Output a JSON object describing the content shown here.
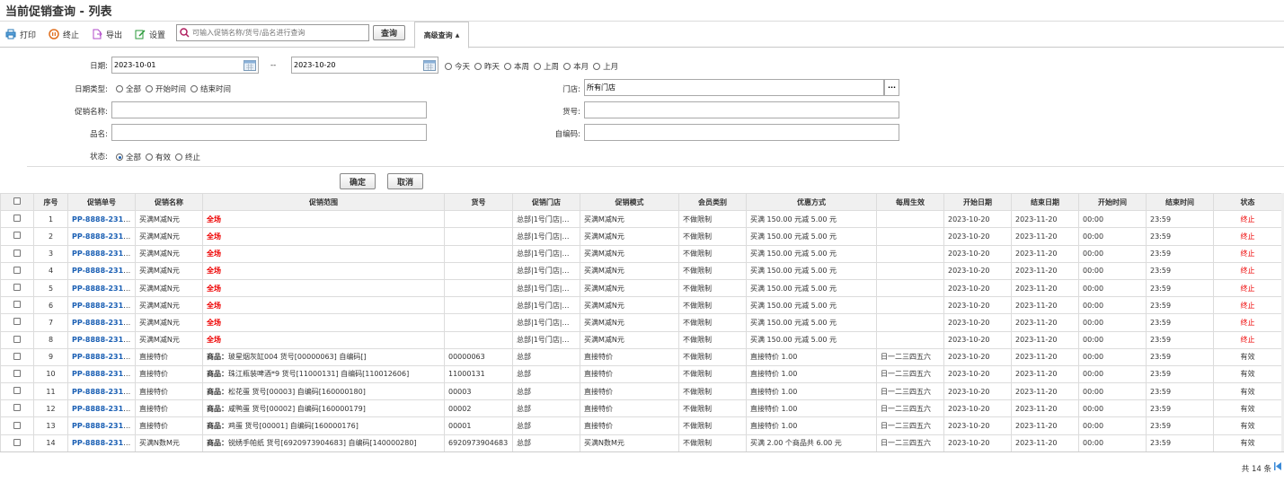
{
  "title": "当前促销查询 - 列表",
  "toolbar": {
    "print": "打印",
    "stop": "终止",
    "export": "导出",
    "settings": "设置",
    "search_placeholder": "可输入促销名称/货号/品名进行查询",
    "query": "查询",
    "advanced": "高级查询"
  },
  "form": {
    "date_label": "日期:",
    "date_from": "2023-10-01",
    "date_sep": "--",
    "date_to": "2023-10-20",
    "date_quick": [
      "今天",
      "昨天",
      "本周",
      "上周",
      "本月",
      "上月"
    ],
    "date_type_label": "日期类型:",
    "date_types": [
      "全部",
      "开始时间",
      "结束时间"
    ],
    "store_label": "门店:",
    "store_value": "所有门店",
    "store_more": "···",
    "promo_name_label": "促销名称:",
    "item_no_label": "货号:",
    "product_name_label": "品名:",
    "self_code_label": "自编码:",
    "status_label": "状态:",
    "statuses": [
      "全部",
      "有效",
      "终止"
    ],
    "confirm": "确定",
    "cancel": "取消"
  },
  "table": {
    "headers": [
      "序号",
      "促销单号",
      "促销名称",
      "促销范围",
      "货号",
      "促销门店",
      "促销模式",
      "会员类别",
      "优惠方式",
      "每周生效",
      "开始日期",
      "结束日期",
      "开始时间",
      "结束时间",
      "状态"
    ],
    "rows": [
      {
        "no": "1",
        "id": "PP-8888-2310...",
        "name": "买满M减N元",
        "scope": "全场",
        "item": "",
        "store": "总部|1号门店|测...",
        "mode": "买满M减N元",
        "member": "不做限制",
        "discount": "买满 150.00 元减 5.00 元",
        "weekly": "",
        "start_date": "2023-10-20",
        "end_date": "2023-11-20",
        "start_time": "00:00",
        "end_time": "23:59",
        "status": "终止"
      },
      {
        "no": "2",
        "id": "PP-8888-2310...",
        "name": "买满M减N元",
        "scope": "全场",
        "item": "",
        "store": "总部|1号门店|测...",
        "mode": "买满M减N元",
        "member": "不做限制",
        "discount": "买满 150.00 元减 5.00 元",
        "weekly": "",
        "start_date": "2023-10-20",
        "end_date": "2023-11-20",
        "start_time": "00:00",
        "end_time": "23:59",
        "status": "终止"
      },
      {
        "no": "3",
        "id": "PP-8888-2310...",
        "name": "买满M减N元",
        "scope": "全场",
        "item": "",
        "store": "总部|1号门店|测...",
        "mode": "买满M减N元",
        "member": "不做限制",
        "discount": "买满 150.00 元减 5.00 元",
        "weekly": "",
        "start_date": "2023-10-20",
        "end_date": "2023-11-20",
        "start_time": "00:00",
        "end_time": "23:59",
        "status": "终止"
      },
      {
        "no": "4",
        "id": "PP-8888-2310...",
        "name": "买满M减N元",
        "scope": "全场",
        "item": "",
        "store": "总部|1号门店|测...",
        "mode": "买满M减N元",
        "member": "不做限制",
        "discount": "买满 150.00 元减 5.00 元",
        "weekly": "",
        "start_date": "2023-10-20",
        "end_date": "2023-11-20",
        "start_time": "00:00",
        "end_time": "23:59",
        "status": "终止"
      },
      {
        "no": "5",
        "id": "PP-8888-2310...",
        "name": "买满M减N元",
        "scope": "全场",
        "item": "",
        "store": "总部|1号门店|测...",
        "mode": "买满M减N元",
        "member": "不做限制",
        "discount": "买满 150.00 元减 5.00 元",
        "weekly": "",
        "start_date": "2023-10-20",
        "end_date": "2023-11-20",
        "start_time": "00:00",
        "end_time": "23:59",
        "status": "终止"
      },
      {
        "no": "6",
        "id": "PP-8888-2310...",
        "name": "买满M减N元",
        "scope": "全场",
        "item": "",
        "store": "总部|1号门店|测...",
        "mode": "买满M减N元",
        "member": "不做限制",
        "discount": "买满 150.00 元减 5.00 元",
        "weekly": "",
        "start_date": "2023-10-20",
        "end_date": "2023-11-20",
        "start_time": "00:00",
        "end_time": "23:59",
        "status": "终止"
      },
      {
        "no": "7",
        "id": "PP-8888-2310...",
        "name": "买满M减N元",
        "scope": "全场",
        "item": "",
        "store": "总部|1号门店|测...",
        "mode": "买满M减N元",
        "member": "不做限制",
        "discount": "买满 150.00 元减 5.00 元",
        "weekly": "",
        "start_date": "2023-10-20",
        "end_date": "2023-11-20",
        "start_time": "00:00",
        "end_time": "23:59",
        "status": "终止"
      },
      {
        "no": "8",
        "id": "PP-8888-2310...",
        "name": "买满M减N元",
        "scope": "全场",
        "item": "",
        "store": "总部|1号门店|测...",
        "mode": "买满M减N元",
        "member": "不做限制",
        "discount": "买满 150.00 元减 5.00 元",
        "weekly": "",
        "start_date": "2023-10-20",
        "end_date": "2023-11-20",
        "start_time": "00:00",
        "end_time": "23:59",
        "status": "终止"
      },
      {
        "no": "9",
        "id": "PP-8888-2310...",
        "name": "直接特价",
        "scope_prefix": "商品：",
        "scope": "玻星烟灰缸004 货号[00000063] 自编码[]",
        "item": "00000063",
        "store": "总部",
        "mode": "直接特价",
        "member": "不做限制",
        "discount": "直接特价 1.00",
        "weekly": "日一二三四五六",
        "start_date": "2023-10-20",
        "end_date": "2023-11-20",
        "start_time": "00:00",
        "end_time": "23:59",
        "status": "有效"
      },
      {
        "no": "10",
        "id": "PP-8888-2310...",
        "name": "直接特价",
        "scope_prefix": "商品：",
        "scope": "珠江瓶装啤酒*9 货号[11000131] 自编码[110012606]",
        "item": "11000131",
        "store": "总部",
        "mode": "直接特价",
        "member": "不做限制",
        "discount": "直接特价 1.00",
        "weekly": "日一二三四五六",
        "start_date": "2023-10-20",
        "end_date": "2023-11-20",
        "start_time": "00:00",
        "end_time": "23:59",
        "status": "有效"
      },
      {
        "no": "11",
        "id": "PP-8888-2310...",
        "name": "直接特价",
        "scope_prefix": "商品：",
        "scope": "松花蛋 货号[00003] 自编码[160000180]",
        "item": "00003",
        "store": "总部",
        "mode": "直接特价",
        "member": "不做限制",
        "discount": "直接特价 1.00",
        "weekly": "日一二三四五六",
        "start_date": "2023-10-20",
        "end_date": "2023-11-20",
        "start_time": "00:00",
        "end_time": "23:59",
        "status": "有效"
      },
      {
        "no": "12",
        "id": "PP-8888-2310...",
        "name": "直接特价",
        "scope_prefix": "商品：",
        "scope": "咸鸭蛋 货号[00002] 自编码[160000179]",
        "item": "00002",
        "store": "总部",
        "mode": "直接特价",
        "member": "不做限制",
        "discount": "直接特价 1.00",
        "weekly": "日一二三四五六",
        "start_date": "2023-10-20",
        "end_date": "2023-11-20",
        "start_time": "00:00",
        "end_time": "23:59",
        "status": "有效"
      },
      {
        "no": "13",
        "id": "PP-8888-2310...",
        "name": "直接特价",
        "scope_prefix": "商品：",
        "scope": "鸡蛋 货号[00001] 自编码[160000176]",
        "item": "00001",
        "store": "总部",
        "mode": "直接特价",
        "member": "不做限制",
        "discount": "直接特价 1.00",
        "weekly": "日一二三四五六",
        "start_date": "2023-10-20",
        "end_date": "2023-11-20",
        "start_time": "00:00",
        "end_time": "23:59",
        "status": "有效"
      },
      {
        "no": "14",
        "id": "PP-8888-2310...",
        "name": "买满N数M元",
        "scope_prefix": "商品：",
        "scope": "锐绣手帕纸 货号[6920973904683] 自编码[140000280]",
        "item": "6920973904683",
        "store": "总部",
        "mode": "买满N数M元",
        "member": "不做限制",
        "discount": "买满 2.00 个商品共 6.00 元",
        "weekly": "日一二三四五六",
        "start_date": "2023-10-20",
        "end_date": "2023-11-20",
        "start_time": "00:00",
        "end_time": "23:59",
        "status": "有效"
      }
    ]
  },
  "footer": {
    "total": "共 14 条"
  },
  "colors": {
    "link": "#1a5fb4",
    "stop": "#e00000"
  }
}
